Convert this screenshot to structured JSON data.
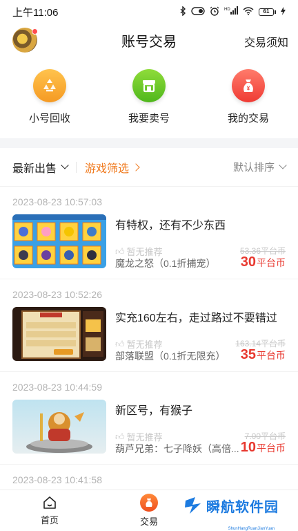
{
  "status_bar": {
    "time": "上午11:06",
    "battery_level": "61",
    "icons": [
      "bluetooth-icon",
      "vpn-icon",
      "alarm-icon",
      "hd-signal-icon",
      "wifi-icon",
      "battery-icon",
      "charging-icon"
    ]
  },
  "header": {
    "title": "账号交易",
    "right_link": "交易须知"
  },
  "quick_actions": [
    {
      "label": "小号回收",
      "icon": "recycle-icon",
      "color": "#f5a623"
    },
    {
      "label": "我要卖号",
      "icon": "shop-icon",
      "color": "#5cbf22"
    },
    {
      "label": "我的交易",
      "icon": "money-bag-icon",
      "color": "#ef4036"
    }
  ],
  "filter_bar": {
    "latest": "最新出售",
    "game_filter": "游戏筛选",
    "sort": "默认排序"
  },
  "listings": [
    {
      "timestamp": "2023-08-23 10:57:03",
      "title": "有特权，还有不少东西",
      "recommend": "暂无推荐",
      "game": "魔龙之怒（0.1折捕宠）",
      "original_price": "53.36平台币",
      "price": "30",
      "price_unit": "平台币"
    },
    {
      "timestamp": "2023-08-23 10:52:26",
      "title": "实充160左右，走过路过不要错过",
      "recommend": "暂无推荐",
      "game": "部落联盟（0.1折无限充）",
      "original_price": "163.14平台币",
      "price": "35",
      "price_unit": "平台币"
    },
    {
      "timestamp": "2023-08-23 10:44:59",
      "title": "新区号，有猴子",
      "recommend": "暂无推荐",
      "game": "葫芦兄弟：七子降妖（高倍...",
      "original_price": "7.00平台币",
      "price": "10",
      "price_unit": "平台币"
    },
    {
      "timestamp": "2023-08-23 10:41:58"
    }
  ],
  "tabbar": [
    {
      "label": "首页",
      "icon": "home-icon"
    },
    {
      "label": "交易",
      "icon": "trade-icon"
    }
  ],
  "watermark": {
    "text": "瞬航软件园",
    "sub": "ShunHangRuanJianYuan"
  },
  "colors": {
    "accent": "#f07a1e",
    "price": "#e8382f"
  }
}
